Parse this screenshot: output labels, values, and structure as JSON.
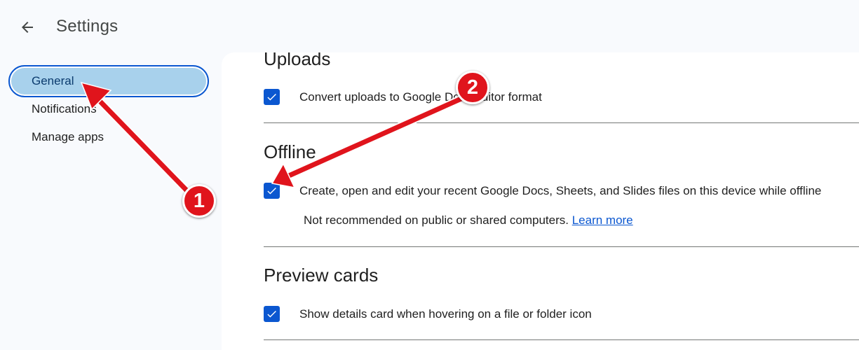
{
  "header": {
    "title": "Settings",
    "back_icon": "arrow-back-icon"
  },
  "sidebar": {
    "items": [
      {
        "label": "General",
        "active": true
      },
      {
        "label": "Notifications",
        "active": false
      },
      {
        "label": "Manage apps",
        "active": false
      }
    ]
  },
  "sections": {
    "uploads": {
      "title": "Uploads",
      "option": {
        "label": "Convert uploads to Google Docs editor format",
        "checked": true
      }
    },
    "offline": {
      "title": "Offline",
      "option": {
        "label": "Create, open and edit your recent Google Docs, Sheets, and Slides files on this device while offline",
        "checked": true
      },
      "note": "Not recommended on public or shared computers.",
      "link": "Learn more"
    },
    "preview_cards": {
      "title": "Preview cards",
      "option": {
        "label": "Show details card when hovering on a file or folder icon",
        "checked": true
      }
    }
  },
  "annotations": {
    "callout_1": "1",
    "callout_2": "2",
    "arrow_color": "#e0141c"
  },
  "colors": {
    "accent": "#0b57d0",
    "active_nav_bg": "#a8d1ec",
    "page_bg": "#f8fafd"
  }
}
